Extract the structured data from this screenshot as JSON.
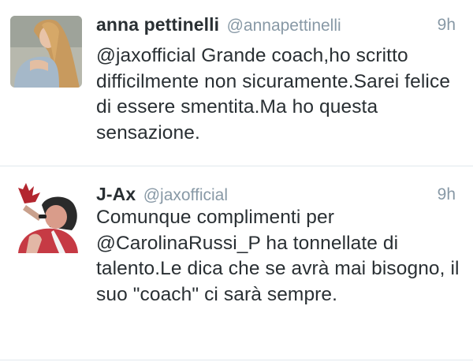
{
  "tweets": [
    {
      "name": "anna pettinelli",
      "handle": "@annapettinelli",
      "time": "9h",
      "text": "@jaxofficial Grande coach,ho scritto difficilmente non sicuramente.Sarei felice di essere smentita.Ma ho questa sensazione."
    },
    {
      "name": "J-Ax",
      "handle": "@jaxofficial",
      "time": "9h",
      "text": "Comunque complimenti per @CarolinaRussi_P ha tonnellate di talento.Le dica che se avrà mai bisogno, il suo \"coach\" ci sarà sempre."
    }
  ]
}
